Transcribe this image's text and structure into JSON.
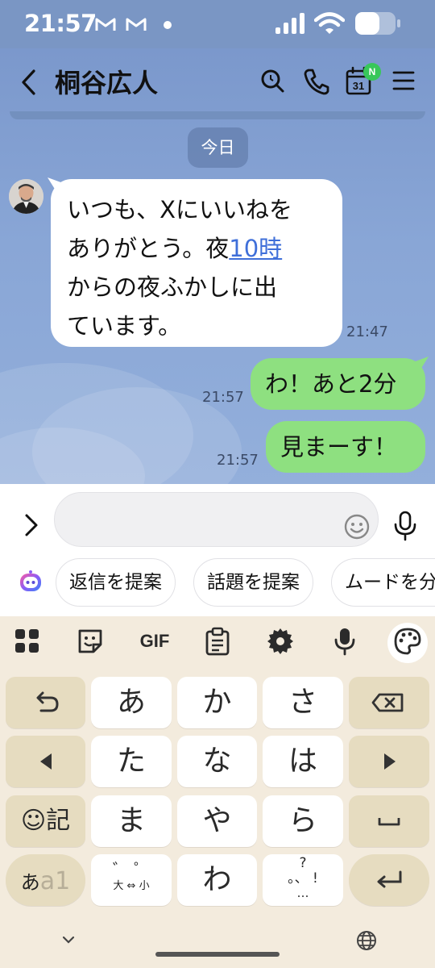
{
  "status_bar": {
    "time": "21:57",
    "notification_icons": [
      "gmail-icon",
      "gmail-icon"
    ],
    "wifi_icon": "wifi-icon",
    "battery_icon": "battery-icon"
  },
  "header": {
    "title": "桐谷広人",
    "calendar_day": "31",
    "calendar_badge": "N"
  },
  "date_separator": "今日",
  "messages": [
    {
      "direction": "incoming",
      "lines": [
        "いつも、Xにいいねを",
        "ありがとう。夜",
        "からの夜ふかしに出",
        "ています。"
      ],
      "link_text": "10時",
      "time": "21:47"
    },
    {
      "direction": "outgoing",
      "text": "わ！あと2分",
      "time": "21:57"
    },
    {
      "direction": "outgoing",
      "text": "見まーす！",
      "time": "21:57"
    }
  ],
  "input": {
    "placeholder": ""
  },
  "suggestions": [
    "返信を提案",
    "話題を提案",
    "ムードを分"
  ],
  "keyboard": {
    "toolbar": [
      "apps-icon",
      "sticker-icon",
      "GIF",
      "clipboard-icon",
      "settings-icon",
      "mic-icon",
      "palette-icon"
    ],
    "rows": [
      [
        "undo-icon",
        "あ",
        "か",
        "さ",
        "backspace-icon"
      ],
      [
        "left-arrow-icon",
        "た",
        "な",
        "は",
        "right-arrow-icon"
      ],
      [
        "☺記",
        "ま",
        "や",
        "ら",
        "space-icon"
      ],
      [
        "あa1",
        "゛゜ 大⇔小",
        "わ",
        "？。、…！",
        "enter-icon"
      ]
    ],
    "kana_switch": {
      "kana": "あ",
      "alpha": "a1"
    },
    "dakuten": {
      "marks": "゛ ゜",
      "caption": "大 ⇔ 小"
    },
    "punct": {
      "top": "?",
      "middle": "。、 !",
      "bottom": "…"
    }
  },
  "colors": {
    "chat_background": "#86a2d3",
    "incoming_bubble": "#ffffff",
    "outgoing_bubble": "#8ee080",
    "link": "#3f6fd9",
    "keyboard_background": "#f3ebdd",
    "function_key": "#e6dcc0"
  }
}
